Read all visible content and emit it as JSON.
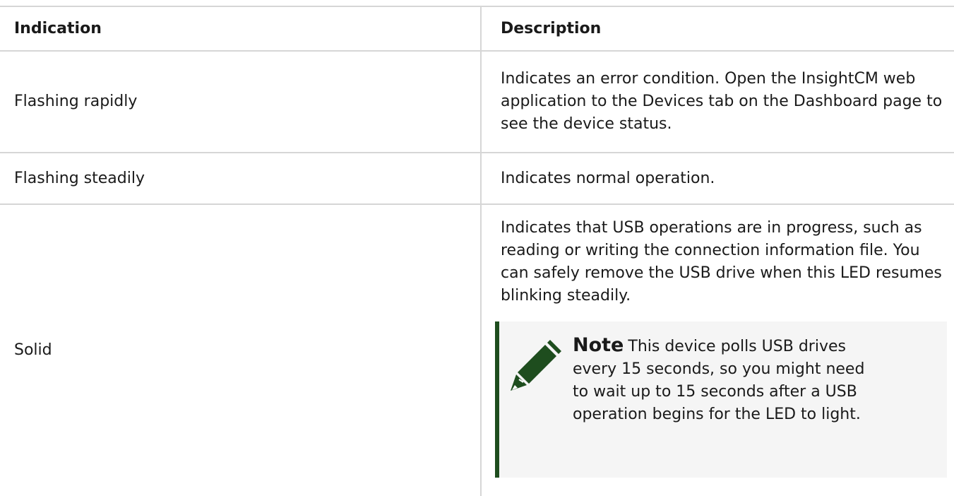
{
  "table": {
    "headers": {
      "indication": "Indication",
      "description": "Description"
    },
    "rows": [
      {
        "indication": "Flashing rapidly",
        "description": "Indicates an error condition. Open the InsightCM web application to the Devices tab on the Dashboard page to see the device status."
      },
      {
        "indication": "Flashing steadily",
        "description": "Indicates normal operation."
      },
      {
        "indication": "Solid",
        "description": "Indicates that USB operations are in progress, such as reading or writing the connection information file. You can safely remove the USB drive when this LED resumes blinking steadily.",
        "note": {
          "label": "Note",
          "text": "This device polls USB drives every 15 seconds, so you might need to wait up to 15 seconds after a USB operation begins for the LED to light.",
          "icon": "pencil-icon"
        }
      }
    ]
  },
  "colors": {
    "grid": "#d6d6d6",
    "note_accent": "#1e4d1e",
    "note_bg": "#f5f5f5"
  }
}
